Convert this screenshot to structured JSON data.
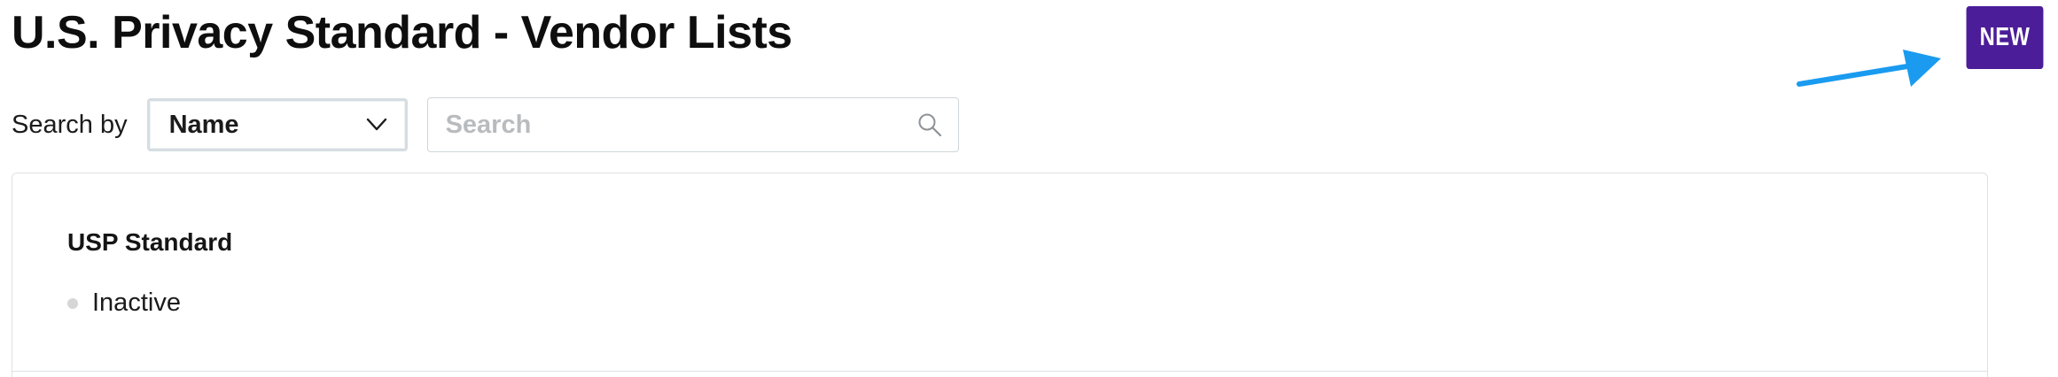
{
  "header": {
    "title": "U.S. Privacy Standard - Vendor Lists",
    "new_button_label": "NEW"
  },
  "search": {
    "label": "Search by",
    "field": {
      "selected": "Name",
      "icon": "chevron-down-icon"
    },
    "input": {
      "value": "",
      "placeholder": "Search",
      "icon": "search-icon"
    }
  },
  "vendor_lists": [
    {
      "name": "USP Standard",
      "status": "Inactive",
      "status_color": "#d6d6d6"
    }
  ],
  "annotation": {
    "icon": "arrow-icon",
    "color": "#1a9bf0"
  },
  "colors": {
    "accent": "#4b1d98"
  }
}
